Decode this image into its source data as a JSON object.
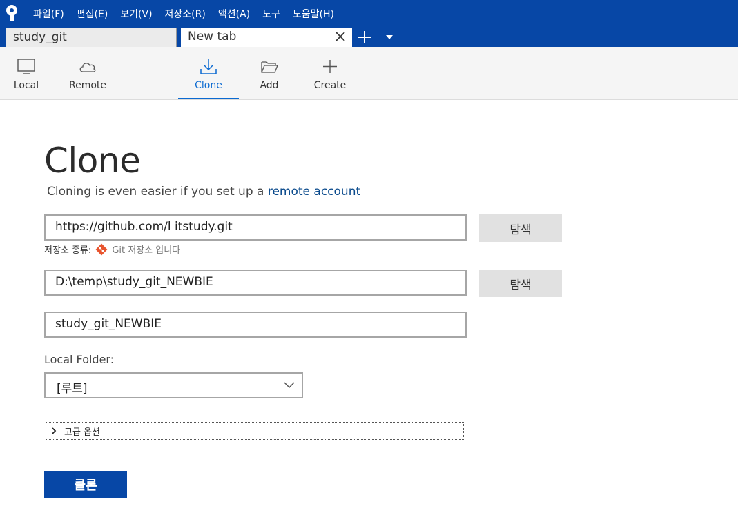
{
  "menu": {
    "items": [
      "파일(F)",
      "편집(E)",
      "보기(V)",
      "저장소(R)",
      "액션(A)",
      "도구",
      "도움말(H)"
    ]
  },
  "tabs": [
    {
      "label": "study_git",
      "active": false
    },
    {
      "label": "New tab",
      "active": true
    }
  ],
  "toolbar": {
    "local": "Local",
    "remote": "Remote",
    "clone": "Clone",
    "add": "Add",
    "create": "Create"
  },
  "main": {
    "title": "Clone",
    "subtitle_prefix": "Cloning is even easier if you set up a ",
    "subtitle_link": "remote account",
    "source_url": "https://github.com/l                    itstudy.git",
    "browse_label_1": "탐색",
    "repo_type_label": "저장소 종류:",
    "repo_type_value": "Git 저장소 입니다",
    "dest_path": "D:\\temp\\study_git_NEWBIE",
    "browse_label_2": "탐색",
    "name": "study_git_NEWBIE",
    "local_folder_label": "Local Folder:",
    "local_folder_value": "[루트]",
    "advanced_label": "고급 옵션",
    "clone_button": "클론"
  },
  "colors": {
    "brand": "#0747a6",
    "accent": "#0b6ad1",
    "git": "#e8542e"
  }
}
